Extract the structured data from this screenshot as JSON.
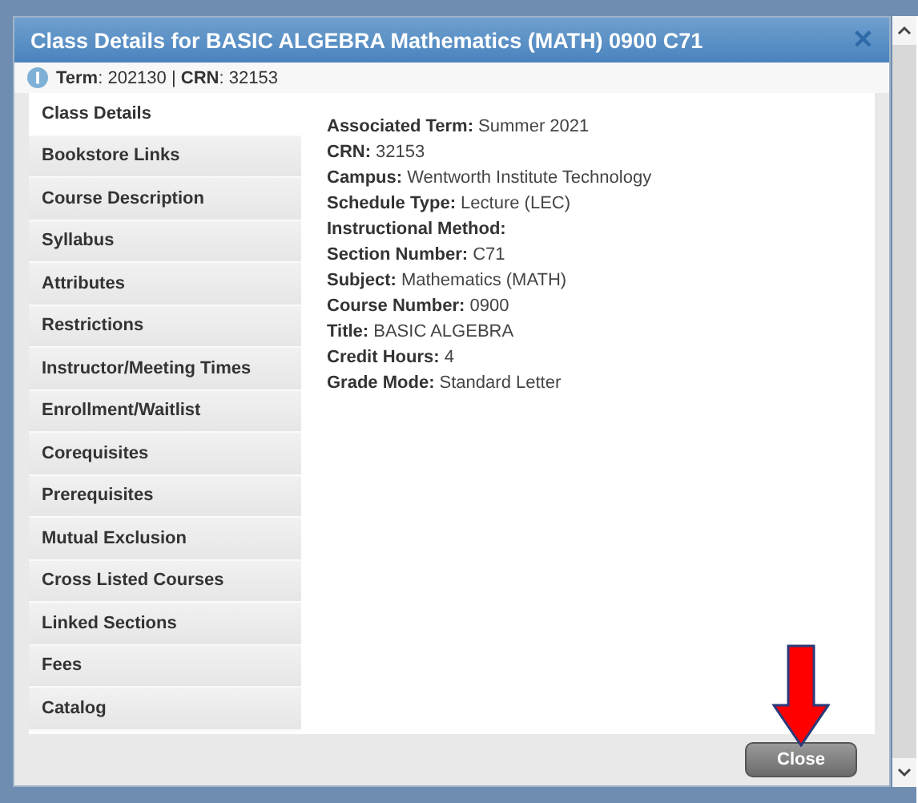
{
  "window": {
    "title": "Class Details for BASIC ALGEBRA Mathematics (MATH) 0900 C71",
    "close_glyph": "✕"
  },
  "info": "**Term**: 202130 | **CRN**: 32153",
  "sidebar": {
    "items": [
      {
        "label": "Class Details",
        "selected": true
      },
      {
        "label": "Bookstore Links",
        "selected": false
      },
      {
        "label": "Course Description",
        "selected": false
      },
      {
        "label": "Syllabus",
        "selected": false
      },
      {
        "label": "Attributes",
        "selected": false
      },
      {
        "label": "Restrictions",
        "selected": false
      },
      {
        "label": "Instructor/Meeting Times",
        "selected": false
      },
      {
        "label": "Enrollment/Waitlist",
        "selected": false
      },
      {
        "label": "Corequisites",
        "selected": false
      },
      {
        "label": "Prerequisites",
        "selected": false
      },
      {
        "label": "Mutual Exclusion",
        "selected": false
      },
      {
        "label": "Cross Listed Courses",
        "selected": false
      },
      {
        "label": "Linked Sections",
        "selected": false
      },
      {
        "label": "Fees",
        "selected": false
      },
      {
        "label": "Catalog",
        "selected": false
      }
    ]
  },
  "details": [
    {
      "label": "Associated Term:",
      "value": "Summer 2021"
    },
    {
      "label": "CRN:",
      "value": "32153"
    },
    {
      "label": "Campus:",
      "value": "Wentworth Institute Technology"
    },
    {
      "label": "Schedule Type:",
      "value": "Lecture (LEC)"
    },
    {
      "label": "Instructional Method:"
    },
    {
      "label": "Section Number:",
      "value": "C71"
    },
    {
      "label": "Subject:",
      "value": "Mathematics (MATH)"
    },
    {
      "label": "Course Number:",
      "value": "0900"
    },
    {
      "label": "Title:",
      "value": "BASIC ALGEBRA"
    },
    {
      "label": "Credit Hours:",
      "value": "4"
    },
    {
      "label": "Grade Mode:",
      "value": "Standard Letter"
    }
  ],
  "buttons": [
    "Close"
  ]
}
